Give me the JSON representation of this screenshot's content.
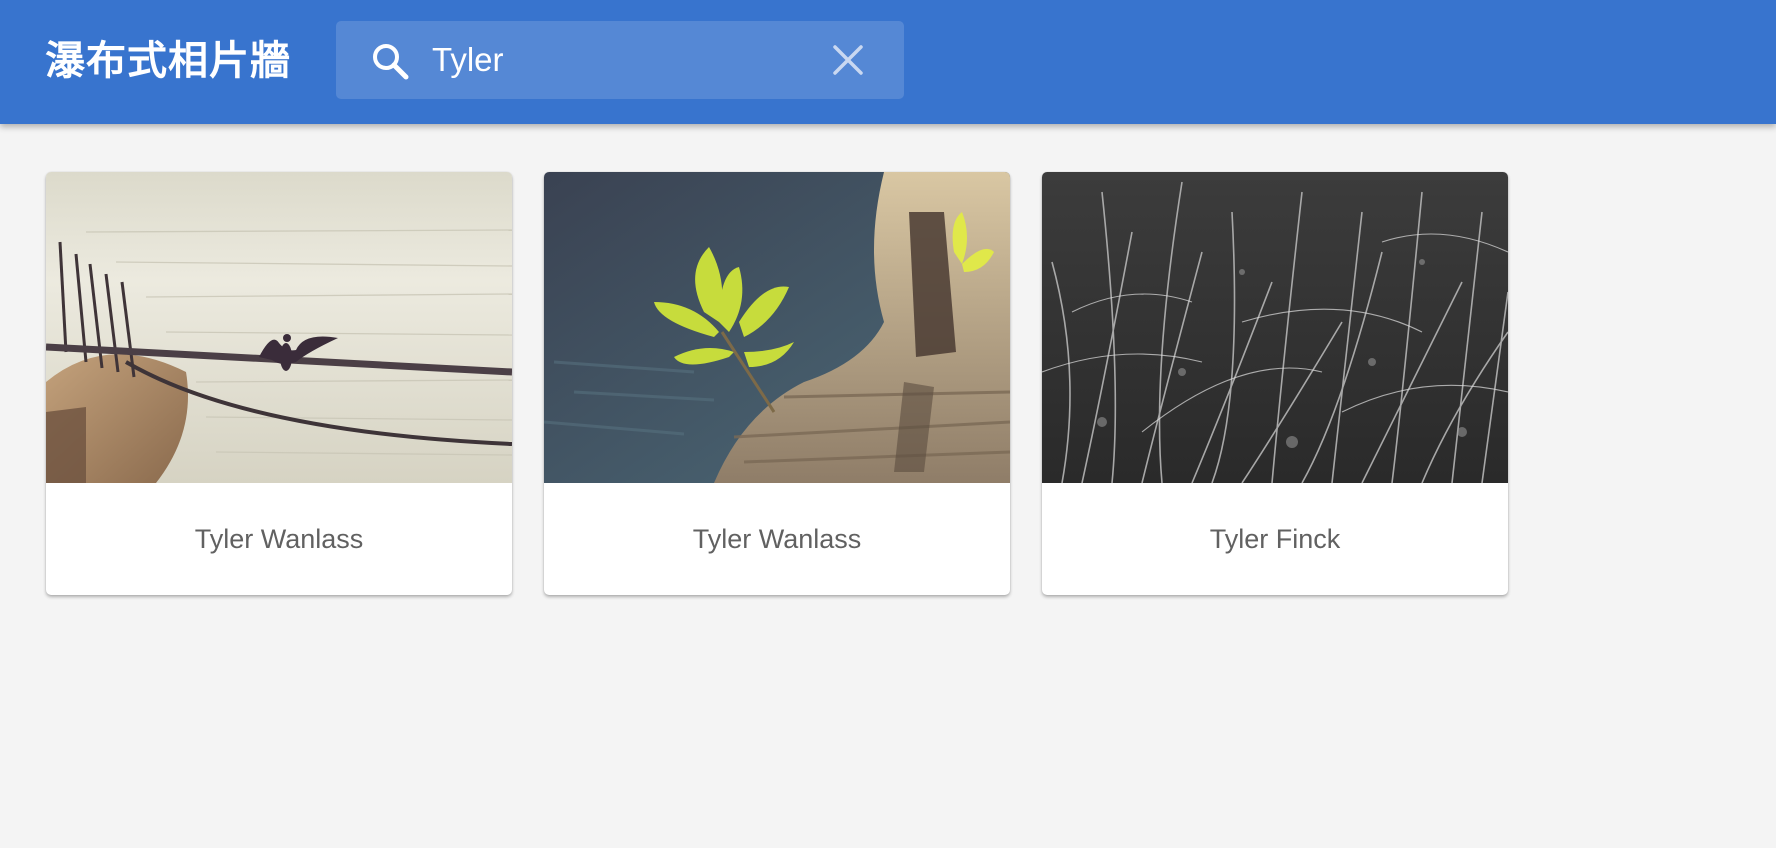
{
  "header": {
    "title": "瀑布式相片牆",
    "background_color": "#3874ce",
    "search": {
      "value": "Tyler",
      "placeholder": "",
      "icon": "search-icon",
      "clear_icon": "close-icon"
    }
  },
  "photos": [
    {
      "caption": "Tyler Wanlass",
      "image": "cormorant-on-rope-over-water"
    },
    {
      "caption": "Tyler Wanlass",
      "image": "green-plant-on-rock-by-water"
    },
    {
      "caption": "Tyler Finck",
      "image": "black-and-white-grass"
    }
  ],
  "colors": {
    "page_background": "#f4f4f4",
    "caption_text": "#616161"
  }
}
